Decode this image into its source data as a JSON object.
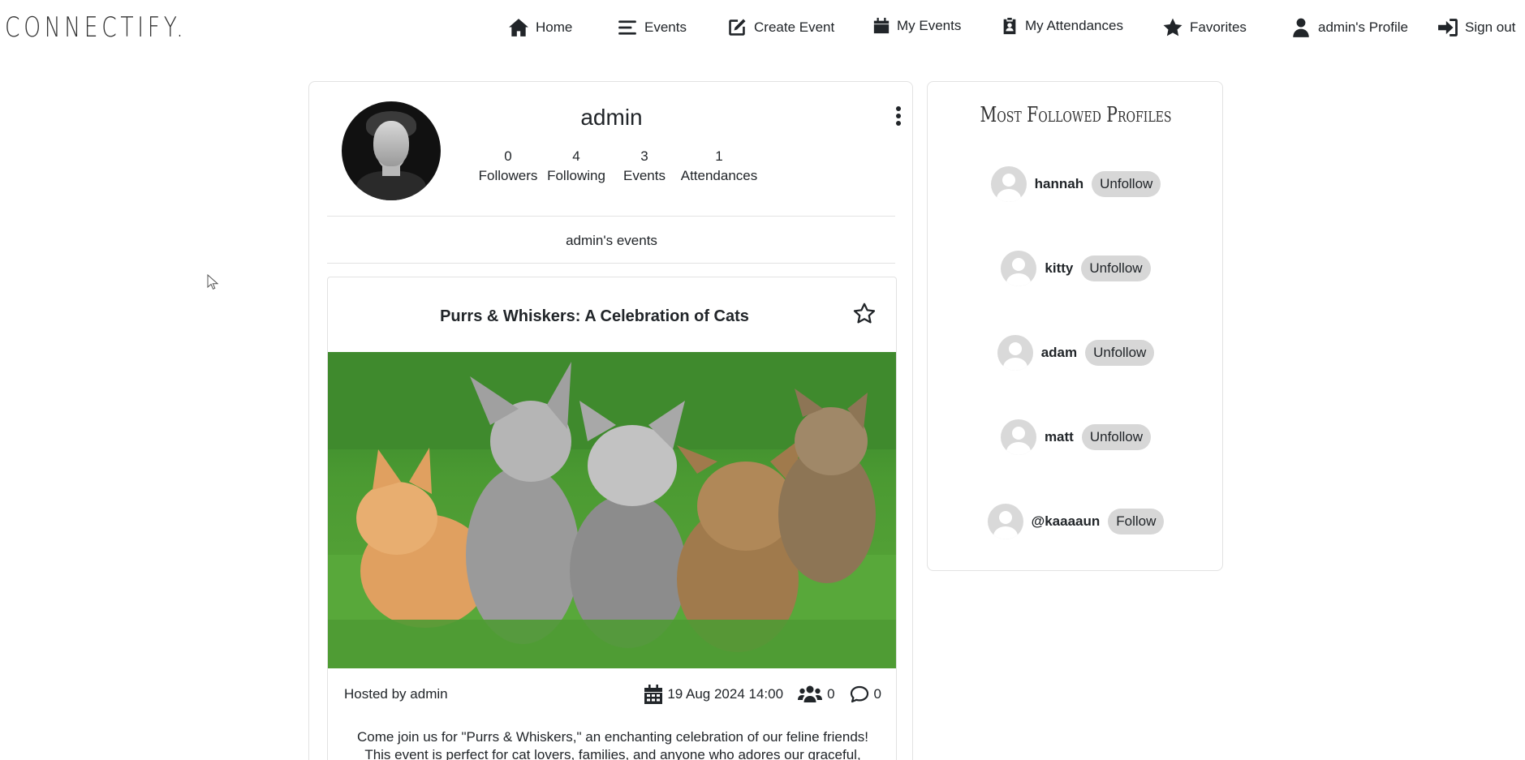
{
  "app": {
    "logo_text": "CONNECTIFY."
  },
  "nav": {
    "items": [
      {
        "label": "Home",
        "icon": "home-icon"
      },
      {
        "label": "Events",
        "icon": "list-icon"
      },
      {
        "label": "Create Event",
        "icon": "edit-icon"
      },
      {
        "label": "My Events",
        "icon": "calendar-icon"
      },
      {
        "label": "My Attendances",
        "icon": "clipboard-user-icon"
      },
      {
        "label": "Favorites",
        "icon": "star-icon"
      },
      {
        "label": "admin's Profile",
        "icon": "user-icon"
      },
      {
        "label": "Sign out",
        "icon": "sign-out-icon"
      }
    ]
  },
  "profile": {
    "username": "admin",
    "stats": [
      {
        "value": "0",
        "label": "Followers"
      },
      {
        "value": "4",
        "label": "Following"
      },
      {
        "value": "3",
        "label": "Events"
      },
      {
        "value": "1",
        "label": "Attendances"
      }
    ],
    "section_label": "admin's events"
  },
  "event": {
    "title": "Purrs & Whiskers: A Celebration of Cats",
    "hosted_prefix": "Hosted by",
    "host": "admin",
    "date": "19 Aug 2024 14:00",
    "attendees": "0",
    "comments": "0",
    "description": "Come join us for \"Purrs & Whiskers,\" an enchanting celebration of our feline friends! This event is perfect for cat lovers, families, and anyone who adores our graceful, whiskered"
  },
  "sidebar": {
    "title": "Most Followed Profiles",
    "profiles": [
      {
        "name": "hannah",
        "button": "Unfollow"
      },
      {
        "name": "kitty",
        "button": "Unfollow"
      },
      {
        "name": "adam",
        "button": "Unfollow"
      },
      {
        "name": "matt",
        "button": "Unfollow"
      },
      {
        "name": "@kaaaaun",
        "button": "Follow"
      }
    ]
  },
  "colors": {
    "text": "#212529",
    "button_bg": "#d7d7d7",
    "border": "#e2e2e2"
  }
}
